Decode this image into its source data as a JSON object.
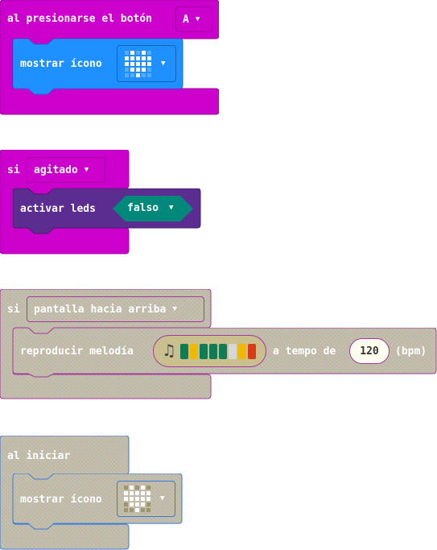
{
  "blocks": {
    "button_event": {
      "label": "al presionarse el botón",
      "button_value": "A",
      "inner": {
        "label": "mostrar ícono",
        "icon": "heart-icon"
      },
      "color": "#cc00cc"
    },
    "shake_event": {
      "label": "si",
      "gesture_value": "agitado",
      "inner": {
        "label": "activar leds",
        "value": "falso"
      },
      "color": "#cc00cc"
    },
    "screen_up_event": {
      "label": "si",
      "gesture_value": "pantalla hacia arriba",
      "inner": {
        "label": "reproducir melodía",
        "tempo_label": "a tempo de",
        "tempo_value": "120",
        "unit_label": "(bpm)",
        "melody_icon": "music-note-icon",
        "melody_colors": [
          "#0e7c55",
          "#f1b800",
          "#0e7c55",
          "#0e7c55",
          "#0e7c55",
          "#d7d7d7",
          "#f1b800",
          "#d83c17"
        ]
      }
    },
    "on_start": {
      "label": "al iniciar",
      "inner": {
        "label": "mostrar ícono",
        "icon": "heart-icon"
      }
    }
  },
  "colors": {
    "magenta": "#cc00cc",
    "blue": "#1e90ff",
    "purple": "#5c2d91",
    "teal": "#00897b"
  }
}
